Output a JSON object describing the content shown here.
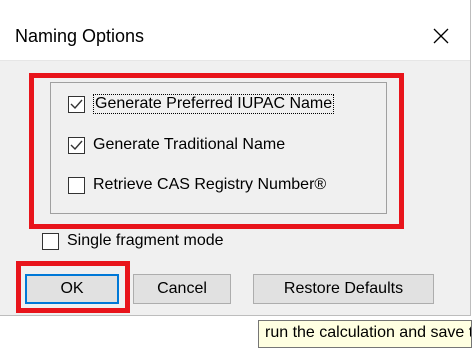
{
  "dialog": {
    "title": "Naming Options",
    "close_label": "✕"
  },
  "options": [
    {
      "label": "Generate Preferred IUPAC Name",
      "checked": true
    },
    {
      "label": "Generate Traditional Name",
      "checked": true
    },
    {
      "label": "Retrieve CAS Registry Number®",
      "checked": false
    }
  ],
  "single_fragment": {
    "label": "Single fragment mode",
    "checked": false
  },
  "buttons": {
    "ok": "OK",
    "cancel": "Cancel",
    "restore": "Restore Defaults"
  },
  "tooltip": "run the calculation and save the settings",
  "colors": {
    "highlight": "#e8141b",
    "check": "#333333",
    "tooltip_bg": "#ffffe1"
  }
}
